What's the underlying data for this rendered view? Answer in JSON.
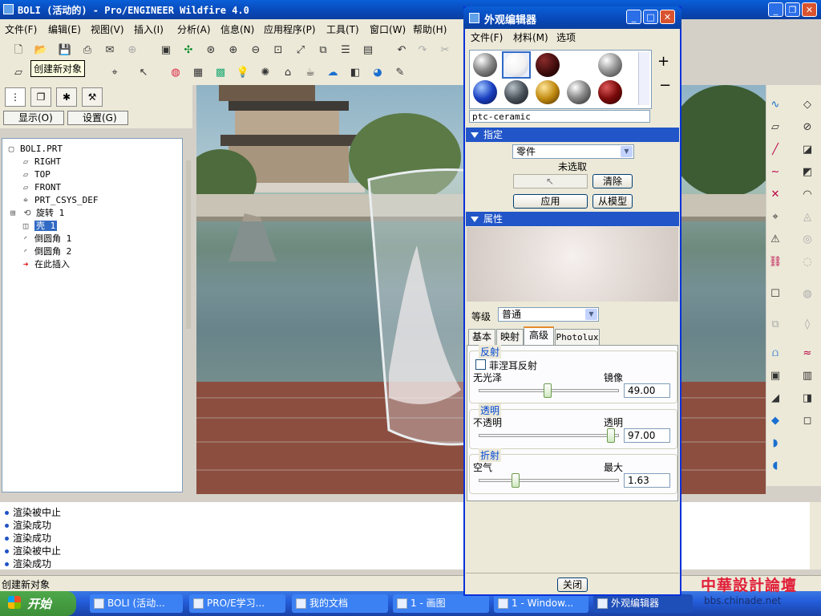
{
  "window": {
    "title": "BOLI (活动的) - Pro/ENGINEER Wildfire 4.0"
  },
  "menubar": [
    "文件(F)",
    "编辑(E)",
    "视图(V)",
    "插入(I)",
    "分析(A)",
    "信息(N)",
    "应用程序(P)",
    "工具(T)",
    "窗口(W)",
    "帮助(H)"
  ],
  "tooltip": "创建新对象",
  "left_panel": {
    "show_label": "显示(O)",
    "settings_label": "设置(G)",
    "tree": [
      {
        "label": "BOLI.PRT",
        "icon": "part-icon"
      },
      {
        "label": "RIGHT",
        "icon": "datum-plane-icon"
      },
      {
        "label": "TOP",
        "icon": "datum-plane-icon"
      },
      {
        "label": "FRONT",
        "icon": "datum-plane-icon"
      },
      {
        "label": "PRT_CSYS_DEF",
        "icon": "csys-icon"
      },
      {
        "label": "旋转 1",
        "icon": "revolve-icon"
      },
      {
        "label": "壳 1",
        "icon": "shell-icon"
      },
      {
        "label": "倒圆角 1",
        "icon": "round-icon"
      },
      {
        "label": "倒圆角 2",
        "icon": "round-icon"
      },
      {
        "label": "在此插入",
        "icon": "insert-here-icon"
      }
    ]
  },
  "messages": [
    "渲染被中止",
    "渲染成功",
    "渲染成功",
    "渲染被中止",
    "渲染成功"
  ],
  "status_text": "创建新对象",
  "taskbar": {
    "start_label": "开始",
    "tasks": [
      "BOLI (活动...",
      "PRO/E学习...",
      "我的文档",
      "1 - 画图",
      "1 - Window...",
      "外观编辑器"
    ],
    "watermark": "中華設計論壇",
    "watermark_url": "bbs.chinade.net"
  },
  "dialog": {
    "title": "外观编辑器",
    "menu": [
      "文件(F)",
      "材料(M)",
      "选项"
    ],
    "add_symbol": "+",
    "remove_symbol": "−",
    "material_name": "ptc-ceramic",
    "assign": {
      "header": "指定",
      "scope": "零件",
      "selection_status": "未选取",
      "clear_label": "清除",
      "apply_label": "应用",
      "from_model_label": "从模型"
    },
    "properties": {
      "header": "属性",
      "quality_label": "等级",
      "quality_value": "普通",
      "tabs": [
        "基本",
        "映射",
        "高级",
        "Photolux"
      ],
      "active_tab": 2,
      "reflection": {
        "title": "反射",
        "fresnel_label": "菲涅耳反射",
        "fresnel_checked": false,
        "min_label": "无光泽",
        "max_label": "镜像",
        "value": "49.00",
        "level": 0.49
      },
      "transparency": {
        "title": "透明",
        "min_label": "不透明",
        "max_label": "透明",
        "value": "97.00",
        "level": 0.97
      },
      "refraction": {
        "title": "折射",
        "min_label": "空气",
        "max_label": "最大",
        "value": "1.63",
        "level": 0.25
      }
    },
    "close_label": "关闭"
  }
}
